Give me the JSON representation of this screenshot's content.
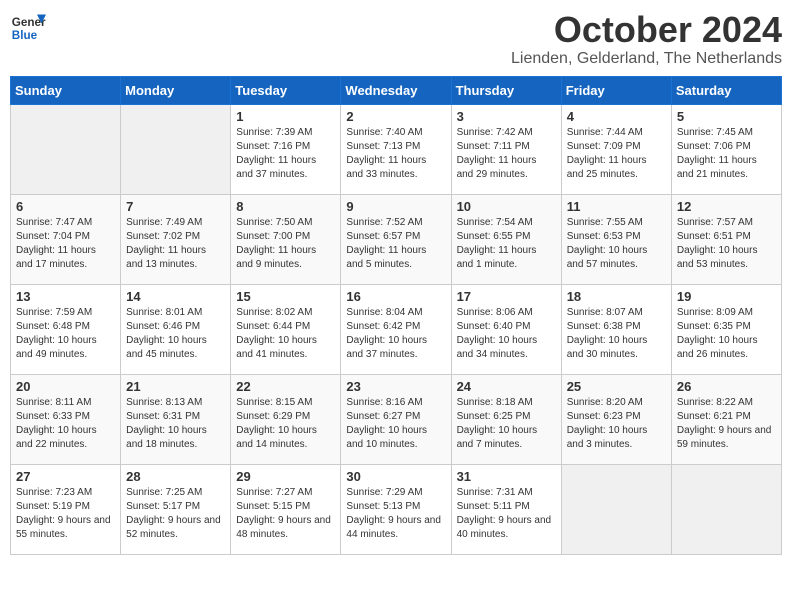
{
  "header": {
    "logo_general": "General",
    "logo_blue": "Blue",
    "month_title": "October 2024",
    "location": "Lienden, Gelderland, The Netherlands"
  },
  "days_of_week": [
    "Sunday",
    "Monday",
    "Tuesday",
    "Wednesday",
    "Thursday",
    "Friday",
    "Saturday"
  ],
  "weeks": [
    [
      {
        "day": "",
        "info": ""
      },
      {
        "day": "",
        "info": ""
      },
      {
        "day": "1",
        "info": "Sunrise: 7:39 AM\nSunset: 7:16 PM\nDaylight: 11 hours and 37 minutes."
      },
      {
        "day": "2",
        "info": "Sunrise: 7:40 AM\nSunset: 7:13 PM\nDaylight: 11 hours and 33 minutes."
      },
      {
        "day": "3",
        "info": "Sunrise: 7:42 AM\nSunset: 7:11 PM\nDaylight: 11 hours and 29 minutes."
      },
      {
        "day": "4",
        "info": "Sunrise: 7:44 AM\nSunset: 7:09 PM\nDaylight: 11 hours and 25 minutes."
      },
      {
        "day": "5",
        "info": "Sunrise: 7:45 AM\nSunset: 7:06 PM\nDaylight: 11 hours and 21 minutes."
      }
    ],
    [
      {
        "day": "6",
        "info": "Sunrise: 7:47 AM\nSunset: 7:04 PM\nDaylight: 11 hours and 17 minutes."
      },
      {
        "day": "7",
        "info": "Sunrise: 7:49 AM\nSunset: 7:02 PM\nDaylight: 11 hours and 13 minutes."
      },
      {
        "day": "8",
        "info": "Sunrise: 7:50 AM\nSunset: 7:00 PM\nDaylight: 11 hours and 9 minutes."
      },
      {
        "day": "9",
        "info": "Sunrise: 7:52 AM\nSunset: 6:57 PM\nDaylight: 11 hours and 5 minutes."
      },
      {
        "day": "10",
        "info": "Sunrise: 7:54 AM\nSunset: 6:55 PM\nDaylight: 11 hours and 1 minute."
      },
      {
        "day": "11",
        "info": "Sunrise: 7:55 AM\nSunset: 6:53 PM\nDaylight: 10 hours and 57 minutes."
      },
      {
        "day": "12",
        "info": "Sunrise: 7:57 AM\nSunset: 6:51 PM\nDaylight: 10 hours and 53 minutes."
      }
    ],
    [
      {
        "day": "13",
        "info": "Sunrise: 7:59 AM\nSunset: 6:48 PM\nDaylight: 10 hours and 49 minutes."
      },
      {
        "day": "14",
        "info": "Sunrise: 8:01 AM\nSunset: 6:46 PM\nDaylight: 10 hours and 45 minutes."
      },
      {
        "day": "15",
        "info": "Sunrise: 8:02 AM\nSunset: 6:44 PM\nDaylight: 10 hours and 41 minutes."
      },
      {
        "day": "16",
        "info": "Sunrise: 8:04 AM\nSunset: 6:42 PM\nDaylight: 10 hours and 37 minutes."
      },
      {
        "day": "17",
        "info": "Sunrise: 8:06 AM\nSunset: 6:40 PM\nDaylight: 10 hours and 34 minutes."
      },
      {
        "day": "18",
        "info": "Sunrise: 8:07 AM\nSunset: 6:38 PM\nDaylight: 10 hours and 30 minutes."
      },
      {
        "day": "19",
        "info": "Sunrise: 8:09 AM\nSunset: 6:35 PM\nDaylight: 10 hours and 26 minutes."
      }
    ],
    [
      {
        "day": "20",
        "info": "Sunrise: 8:11 AM\nSunset: 6:33 PM\nDaylight: 10 hours and 22 minutes."
      },
      {
        "day": "21",
        "info": "Sunrise: 8:13 AM\nSunset: 6:31 PM\nDaylight: 10 hours and 18 minutes."
      },
      {
        "day": "22",
        "info": "Sunrise: 8:15 AM\nSunset: 6:29 PM\nDaylight: 10 hours and 14 minutes."
      },
      {
        "day": "23",
        "info": "Sunrise: 8:16 AM\nSunset: 6:27 PM\nDaylight: 10 hours and 10 minutes."
      },
      {
        "day": "24",
        "info": "Sunrise: 8:18 AM\nSunset: 6:25 PM\nDaylight: 10 hours and 7 minutes."
      },
      {
        "day": "25",
        "info": "Sunrise: 8:20 AM\nSunset: 6:23 PM\nDaylight: 10 hours and 3 minutes."
      },
      {
        "day": "26",
        "info": "Sunrise: 8:22 AM\nSunset: 6:21 PM\nDaylight: 9 hours and 59 minutes."
      }
    ],
    [
      {
        "day": "27",
        "info": "Sunrise: 7:23 AM\nSunset: 5:19 PM\nDaylight: 9 hours and 55 minutes."
      },
      {
        "day": "28",
        "info": "Sunrise: 7:25 AM\nSunset: 5:17 PM\nDaylight: 9 hours and 52 minutes."
      },
      {
        "day": "29",
        "info": "Sunrise: 7:27 AM\nSunset: 5:15 PM\nDaylight: 9 hours and 48 minutes."
      },
      {
        "day": "30",
        "info": "Sunrise: 7:29 AM\nSunset: 5:13 PM\nDaylight: 9 hours and 44 minutes."
      },
      {
        "day": "31",
        "info": "Sunrise: 7:31 AM\nSunset: 5:11 PM\nDaylight: 9 hours and 40 minutes."
      },
      {
        "day": "",
        "info": ""
      },
      {
        "day": "",
        "info": ""
      }
    ]
  ]
}
